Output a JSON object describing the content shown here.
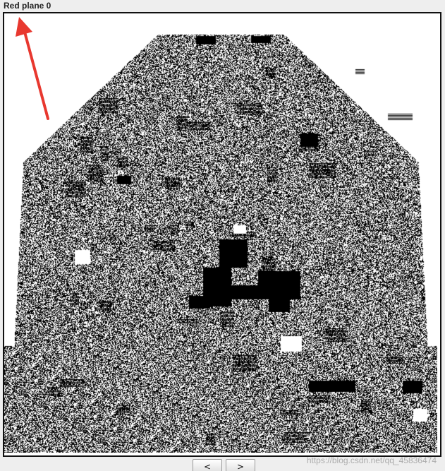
{
  "panel": {
    "title": "Red plane 0"
  },
  "navigation": {
    "prev_label": "<",
    "next_label": ">"
  },
  "watermark": {
    "text": "https://blog.csdn.net/qq_45836474"
  },
  "colors": {
    "annotation_arrow": "#e8382f",
    "pixel_on": "#000000",
    "pixel_off": "#ffffff",
    "background": "#eeeeee"
  }
}
